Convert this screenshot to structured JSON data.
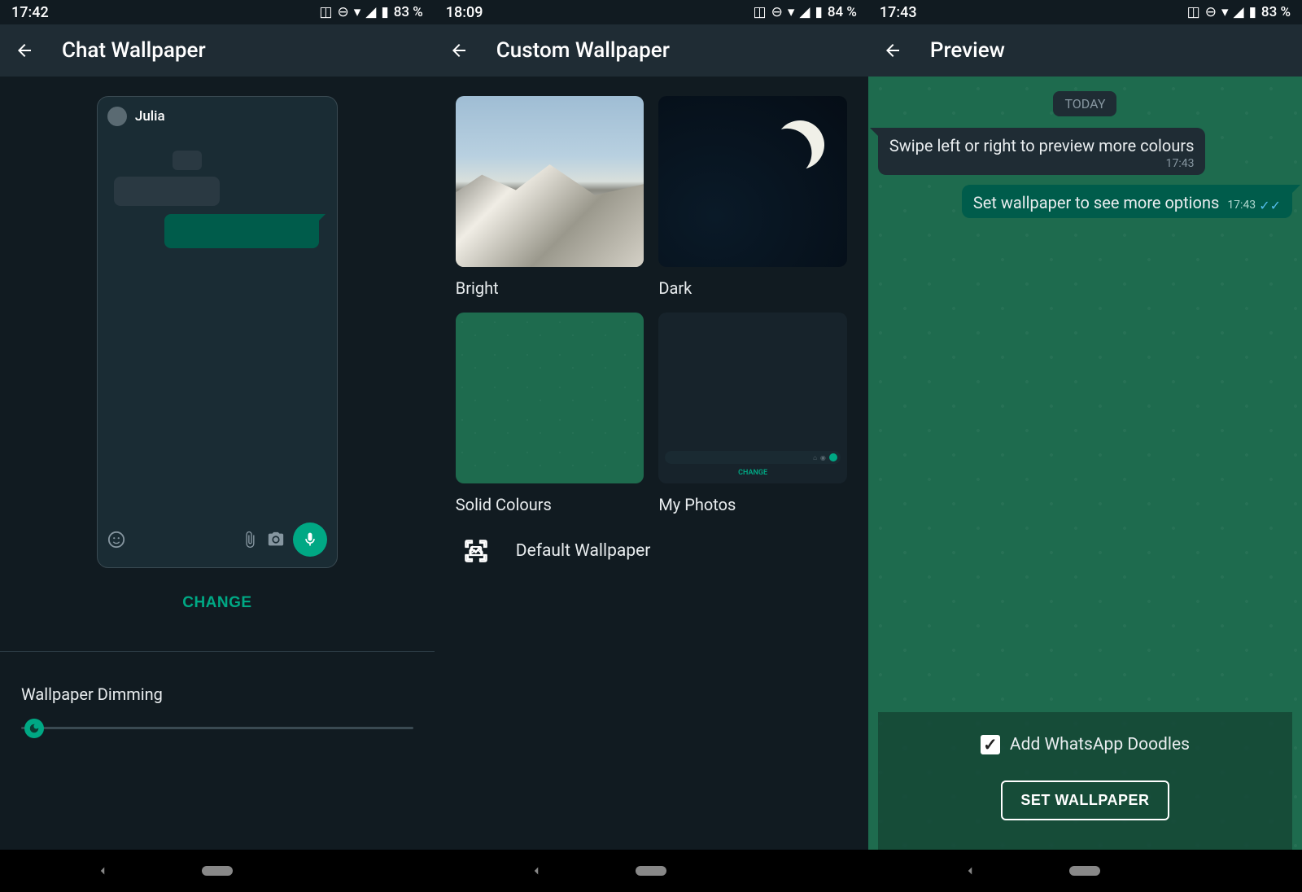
{
  "screen1": {
    "status_time": "17:42",
    "battery": "83 %",
    "title": "Chat Wallpaper",
    "chat_name": "Julia",
    "change_button": "CHANGE",
    "dimming_label": "Wallpaper Dimming"
  },
  "screen2": {
    "status_time": "18:09",
    "battery": "84 %",
    "title": "Custom Wallpaper",
    "options": {
      "bright": "Bright",
      "dark": "Dark",
      "solid": "Solid Colours",
      "photos": "My Photos",
      "photos_change": "CHANGE"
    },
    "default_label": "Default Wallpaper"
  },
  "screen3": {
    "status_time": "17:43",
    "battery": "83 %",
    "title": "Preview",
    "today": "TODAY",
    "msg_in": "Swipe left or right to preview more colours",
    "msg_in_time": "17:43",
    "msg_out": "Set wallpaper to see more options",
    "msg_out_time": "17:43",
    "doodles_label": "Add WhatsApp Doodles",
    "set_button": "SET WALLPAPER"
  }
}
